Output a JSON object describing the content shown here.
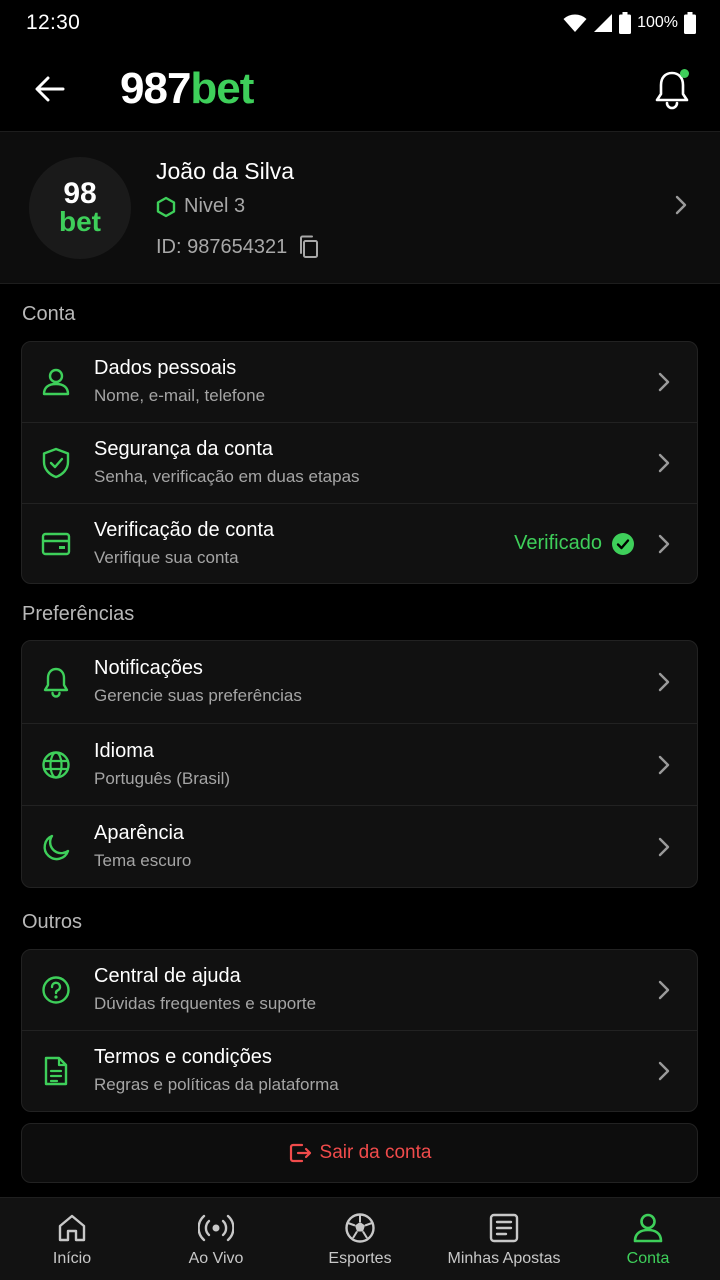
{
  "status_bar": {
    "time": "12:30",
    "battery": "100%"
  },
  "header": {
    "logo_part1": "987",
    "logo_part2": "bet"
  },
  "profile": {
    "avatar_line1": "98",
    "avatar_line2": "bet",
    "name": "João da Silva",
    "level": "Nivel 3",
    "id_text": "ID: 987654321"
  },
  "sections": {
    "conta": {
      "label": "Conta",
      "items": [
        {
          "title": "Dados pessoais",
          "subtitle": "Nome, e-mail, telefone"
        },
        {
          "title": "Segurança da conta",
          "subtitle": "Senha, verificação em duas etapas"
        },
        {
          "title": "Verificação de conta",
          "subtitle": "Verifique sua conta",
          "status": "Verificado"
        }
      ]
    },
    "preferencias": {
      "label": "Preferências",
      "items": [
        {
          "title": "Notificações",
          "subtitle": "Gerencie suas preferências"
        },
        {
          "title": "Idioma",
          "subtitle": "Português (Brasil)"
        },
        {
          "title": "Aparência",
          "subtitle": "Tema escuro"
        }
      ]
    },
    "outros": {
      "label": "Outros",
      "items": [
        {
          "title": "Central de ajuda",
          "subtitle": "Dúvidas frequentes e suporte"
        },
        {
          "title": "Termos e condições",
          "subtitle": "Regras e políticas da plataforma"
        }
      ]
    }
  },
  "logout": {
    "label": "Sair da conta"
  },
  "bottom_nav": [
    {
      "label": "Início"
    },
    {
      "label": "Ao Vivo"
    },
    {
      "label": "Esportes"
    },
    {
      "label": "Minhas Apostas"
    },
    {
      "label": "Conta"
    }
  ],
  "colors": {
    "accent": "#3ecf5a",
    "danger": "#f04b4b",
    "background": "#000000"
  }
}
